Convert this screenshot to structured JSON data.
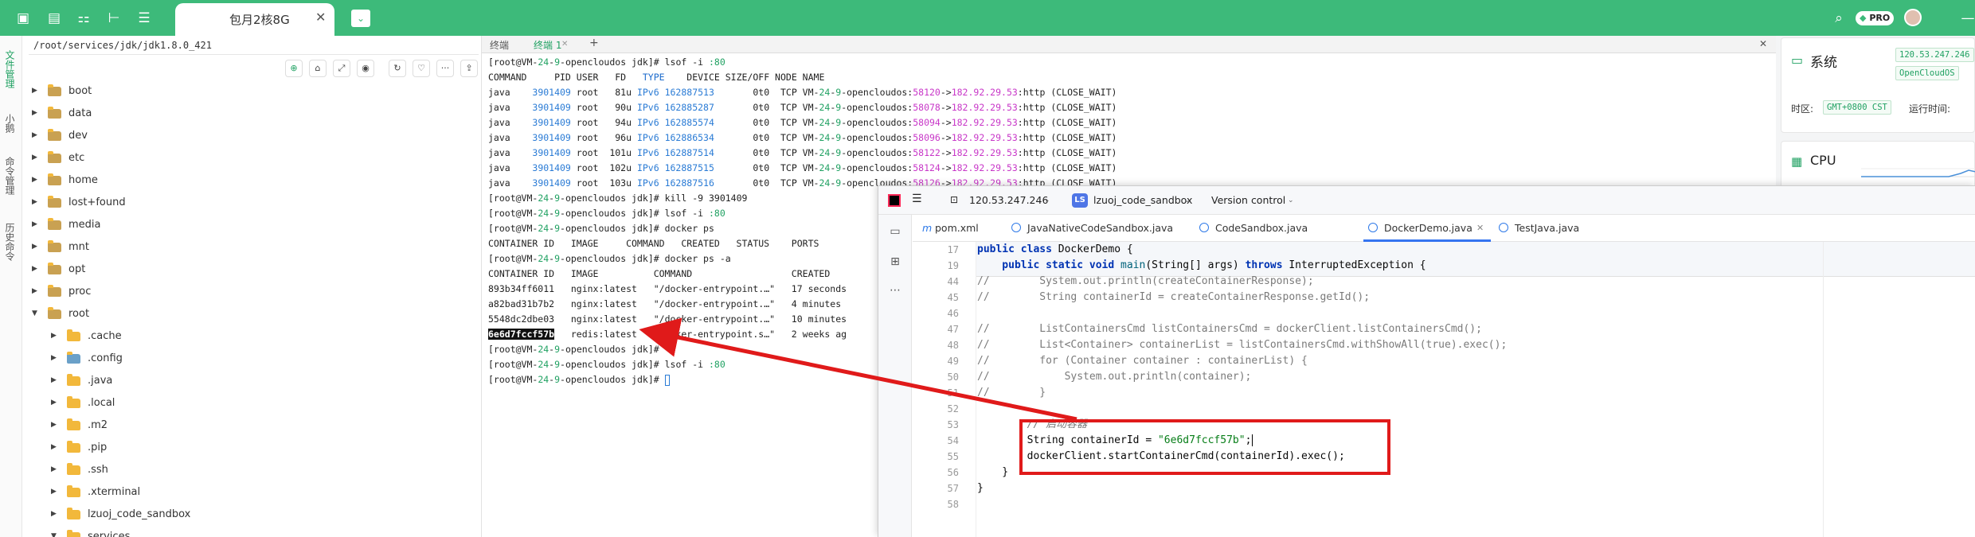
{
  "topbar": {
    "tab_title": "包月2核8G",
    "tab_close": "✕",
    "tab_dropdown": "⌄",
    "pro_badge": "PRO",
    "accent": "#3dba7a"
  },
  "left_tabs": [
    "文件管理",
    "小鹅",
    "命令管理",
    "历史命令"
  ],
  "filetree": {
    "path": "/root/services/jdk/jdk1.8.0_421",
    "tools": [
      "⊕",
      "⌂",
      "⤢",
      "◉",
      "↻",
      "♡",
      "···",
      "⇪"
    ],
    "items": [
      {
        "name": "boot",
        "level": 0,
        "expanded": false
      },
      {
        "name": "data",
        "level": 0,
        "expanded": false
      },
      {
        "name": "dev",
        "level": 0,
        "expanded": false
      },
      {
        "name": "etc",
        "level": 0,
        "expanded": false
      },
      {
        "name": "home",
        "level": 0,
        "expanded": false
      },
      {
        "name": "lost+found",
        "level": 0,
        "expanded": false
      },
      {
        "name": "media",
        "level": 0,
        "expanded": false
      },
      {
        "name": "mnt",
        "level": 0,
        "expanded": false
      },
      {
        "name": "opt",
        "level": 0,
        "expanded": false
      },
      {
        "name": "proc",
        "level": 0,
        "expanded": false
      },
      {
        "name": "root",
        "level": 0,
        "expanded": true
      },
      {
        "name": ".cache",
        "level": 1,
        "expanded": false
      },
      {
        "name": ".config",
        "level": 1,
        "expanded": false
      },
      {
        "name": ".java",
        "level": 1,
        "expanded": false
      },
      {
        "name": ".local",
        "level": 1,
        "expanded": false
      },
      {
        "name": ".m2",
        "level": 1,
        "expanded": false
      },
      {
        "name": ".pip",
        "level": 1,
        "expanded": false
      },
      {
        "name": ".ssh",
        "level": 1,
        "expanded": false
      },
      {
        "name": ".xterminal",
        "level": 1,
        "expanded": false
      },
      {
        "name": "lzuoj_code_sandbox",
        "level": 1,
        "expanded": false
      },
      {
        "name": "services",
        "level": 1,
        "expanded": true
      }
    ]
  },
  "terminal": {
    "tabs": [
      "终端",
      "终端 1"
    ],
    "new_tab": "+",
    "close": "✕",
    "prompt_user": "[root@VM-",
    "prompt_num": "24",
    "prompt_dash": "-",
    "prompt_num2": "9",
    "prompt_host": "-opencloudos jdk]#",
    "cmd1": " lsof -i ",
    "cmd1_port": ":80",
    "lsof_header": "COMMAND     PID USER   FD   ",
    "lsof_header_type": "TYPE",
    "lsof_header_rest": "    DEVICE SIZE/OFF NODE NAME",
    "lsof_rows": [
      {
        "fd": "81u",
        "device": "162887513",
        "port": "58120"
      },
      {
        "fd": "90u",
        "device": "162885287",
        "port": "58078"
      },
      {
        "fd": "94u",
        "device": "162885574",
        "port": "58094"
      },
      {
        "fd": "96u",
        "device": "162886534",
        "port": "58096"
      },
      {
        "fd": "101u",
        "device": "162887514",
        "port": "58122"
      },
      {
        "fd": "102u",
        "device": "162887515",
        "port": "58124"
      },
      {
        "fd": "103u",
        "device": "162887516",
        "port": "58126"
      }
    ],
    "lsof_cmd": "java",
    "lsof_pid": "3901409",
    "lsof_user": "root",
    "lsof_type": "IPv6",
    "lsof_size": "0t0",
    "lsof_node": "TCP",
    "lsof_local": "VM-",
    "lsof_local2": "-opencloudos:",
    "lsof_arrow": "->",
    "lsof_remote": "182.92.29.53",
    "lsof_state": ":http (CLOSE_WAIT)",
    "kill_cmd": " kill -9 3901409",
    "docker_ps": " docker ps",
    "docker_ps_header": "CONTAINER ID   IMAGE     COMMAND   CREATED   STATUS    PORTS",
    "docker_ps_a": " docker ps -a",
    "docker_psa_header": "CONTAINER ID   IMAGE          COMMAND                  CREATED",
    "containers": [
      {
        "id": "893b34ff6011",
        "image": "nginx:latest",
        "command": "\"/docker-entrypoint.…\"",
        "created": "17 seconds"
      },
      {
        "id": "a82bad31b7b2",
        "image": "nginx:latest",
        "command": "\"/docker-entrypoint.…\"",
        "created": "4 minutes"
      },
      {
        "id": "5548dc2dbe03",
        "image": "nginx:latest",
        "command": "\"/docker-entrypoint.…\"",
        "created": "10 minutes"
      },
      {
        "id": "6e6d7fccf57b",
        "image": "redis:latest",
        "command": "\"docker-entrypoint.s…\"",
        "created": "2 weeks ag"
      }
    ]
  },
  "right_panel": {
    "system_title": "系统",
    "ip": "120.53.247.246",
    "os": "OpenCloudOS",
    "tz_label": "时区:",
    "tz_value": "GMT+0800  CST",
    "uptime_label": "运行时间:",
    "cpu_title": "CPU"
  },
  "ide": {
    "host": "120.53.247.246",
    "project_badge": "LS",
    "project": "lzuoj_code_sandbox",
    "vcs": "Version control",
    "tabs": [
      {
        "label": "pom.xml",
        "icon": "m"
      },
      {
        "label": "JavaNativeCodeSandbox.java",
        "icon": "c"
      },
      {
        "label": "CodeSandbox.java",
        "icon": "c"
      },
      {
        "label": "DockerDemo.java",
        "icon": "c"
      },
      {
        "label": "TestJava.java",
        "icon": "c"
      }
    ],
    "line_numbers": [
      "17",
      "19",
      "44",
      "45",
      "46",
      "47",
      "48",
      "49",
      "50",
      "51",
      "52",
      "53",
      "54",
      "55",
      "56",
      "57",
      "58"
    ],
    "code": {
      "l17_kw": "public class ",
      "l17_rest": "DockerDemo {",
      "l19_kw1": "    public static void ",
      "l19_name": "main",
      "l19_mid": "(String[] args) ",
      "l19_kw2": "throws ",
      "l19_rest": "InterruptedException {",
      "l44": "//        System.out.println(createContainerResponse);",
      "l45": "//        String containerId = createContainerResponse.getId();",
      "l46": "",
      "l47": "//        ListContainersCmd listContainersCmd = dockerClient.listContainersCmd();",
      "l48": "//        List<Container> containerList = listContainersCmd.withShowAll(true).exec();",
      "l49": "//        for (Container container : containerList) {",
      "l50": "//            System.out.println(container);",
      "l51": "//        }",
      "l53": "        // 启动容器",
      "l54_a": "        String containerId = ",
      "l54_str": "\"6e6d7fccf57b\"",
      "l54_b": ";",
      "l55": "        dockerClient.startContainerCmd(containerId).exec();",
      "l56": "    }",
      "l57": "}"
    }
  },
  "annotation_color": "#e01a1a"
}
